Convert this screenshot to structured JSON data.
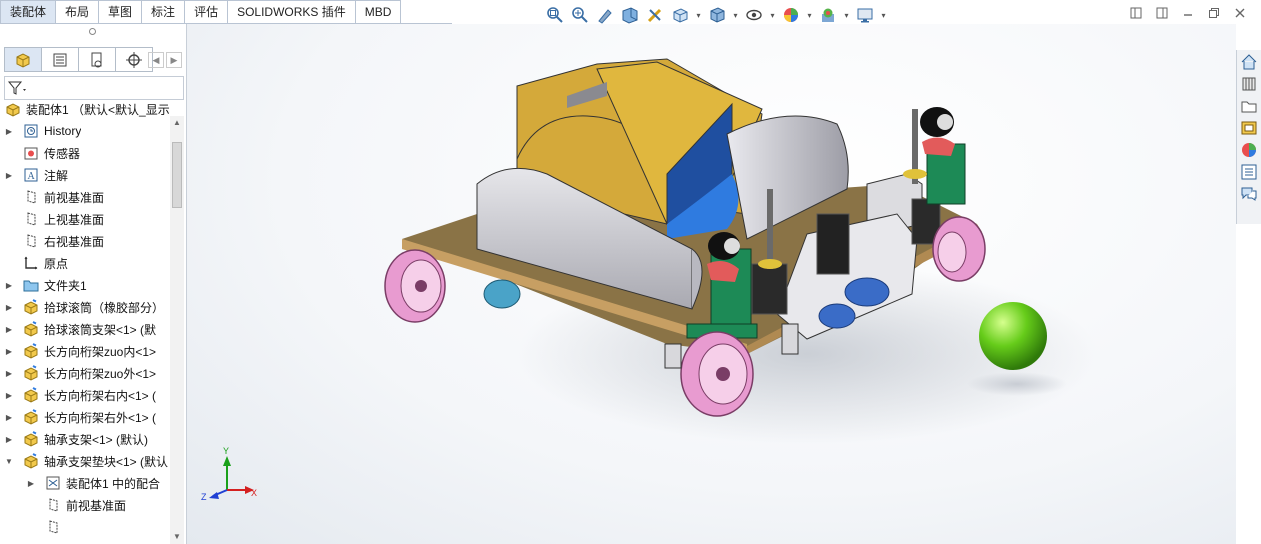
{
  "tabs": [
    "装配体",
    "布局",
    "草图",
    "标注",
    "评估",
    "SOLIDWORKS 插件",
    "MBD"
  ],
  "active_tab": "装配体",
  "heads_up_icons": [
    "zoom-to-fit-icon",
    "zoom-to-area-icon",
    "previous-view-icon",
    "section-view-icon",
    "dynamic-annotation-icon",
    "view-orientation-icon",
    "display-style-icon",
    "hide-show-icon",
    "edit-appearance-icon",
    "apply-scene-icon",
    "view-settings-icon"
  ],
  "feature_manager": {
    "panel_tabs": [
      "featuremanager-tab-icon",
      "propertymanager-tab-icon",
      "configurationmanager-tab-icon",
      "dimxpert-tab-icon"
    ],
    "root": "装配体1 （默认<默认_显示",
    "items": [
      {
        "label": "History",
        "icon": "history-icon",
        "expandable": true,
        "expanded": false,
        "indent": 0
      },
      {
        "label": "传感器",
        "icon": "sensor-icon",
        "expandable": false,
        "indent": 0
      },
      {
        "label": "注解",
        "icon": "annotation-icon",
        "expandable": true,
        "expanded": false,
        "indent": 0
      },
      {
        "label": "前视基准面",
        "icon": "plane-icon",
        "expandable": false,
        "indent": 0
      },
      {
        "label": "上视基准面",
        "icon": "plane-icon",
        "expandable": false,
        "indent": 0
      },
      {
        "label": "右视基准面",
        "icon": "plane-icon",
        "expandable": false,
        "indent": 0
      },
      {
        "label": "原点",
        "icon": "origin-icon",
        "expandable": false,
        "indent": 0
      },
      {
        "label": "文件夹1",
        "icon": "folder-icon",
        "expandable": true,
        "expanded": false,
        "indent": 0
      },
      {
        "label": "拾球滚筒（橡胶部分）",
        "icon": "part-icon",
        "expandable": true,
        "expanded": false,
        "indent": 0
      },
      {
        "label": "拾球滚筒支架<1> (默",
        "icon": "part-icon",
        "expandable": true,
        "expanded": false,
        "indent": 0
      },
      {
        "label": "长方向桁架zuo内<1>",
        "icon": "part-icon",
        "expandable": true,
        "expanded": false,
        "indent": 0
      },
      {
        "label": "长方向桁架zuo外<1>",
        "icon": "part-icon",
        "expandable": true,
        "expanded": false,
        "indent": 0
      },
      {
        "label": "长方向桁架右内<1> (",
        "icon": "part-icon",
        "expandable": true,
        "expanded": false,
        "indent": 0
      },
      {
        "label": "长方向桁架右外<1> (",
        "icon": "part-icon",
        "expandable": true,
        "expanded": false,
        "indent": 0
      },
      {
        "label": "轴承支架<1> (默认)",
        "icon": "part-icon",
        "expandable": true,
        "expanded": false,
        "indent": 0
      },
      {
        "label": "轴承支架垫块<1> (默认",
        "icon": "part-icon",
        "expandable": true,
        "expanded": true,
        "indent": 0
      },
      {
        "label": "装配体1 中的配合",
        "icon": "mates-icon",
        "expandable": true,
        "expanded": false,
        "indent": 1
      },
      {
        "label": "前视基准面",
        "icon": "plane-icon",
        "expandable": false,
        "indent": 1
      },
      {
        "label": "",
        "icon": "plane-icon",
        "expandable": false,
        "indent": 1
      }
    ]
  },
  "triad": {
    "x": "X",
    "y": "Y",
    "z": "Z"
  },
  "task_pane_icons": [
    "resources-icon",
    "design-library-icon",
    "file-explorer-icon",
    "view-palette-icon",
    "appearances-icon",
    "custom-properties-icon",
    "forum-icon"
  ],
  "colors": {
    "wheel": "#e89bd0",
    "ball": "#66cc1a",
    "drum": "#d4a93a",
    "frame": "#d9dade"
  }
}
